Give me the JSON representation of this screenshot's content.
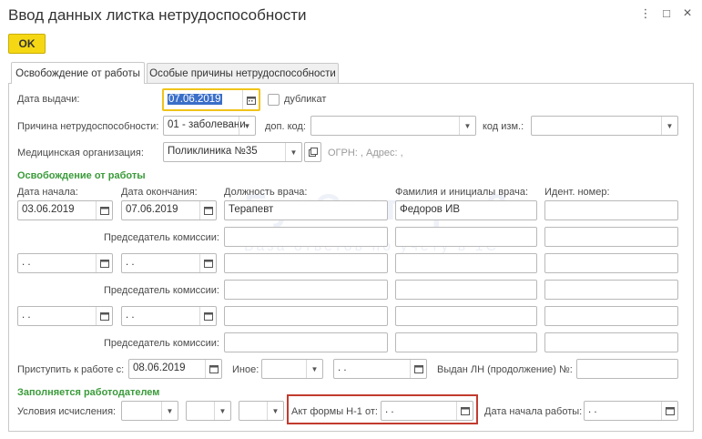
{
  "window": {
    "title": "Ввод данных листка нетрудоспособности",
    "controls": {
      "options": "⋮",
      "maximize": "□",
      "close": "×"
    }
  },
  "toolbar": {
    "ok_label": "OK"
  },
  "tabs": [
    {
      "label": "Освобождение от работы",
      "active": true
    },
    {
      "label": "Особые причины нетрудоспособности",
      "active": false
    }
  ],
  "form": {
    "issue_date_label": "Дата выдачи:",
    "issue_date_value": "07.06.2019",
    "duplicate_label": "дубликат",
    "reason_label": "Причина нетрудоспособности:",
    "reason_value": "01 - заболевани",
    "extra_code_label": "доп. код:",
    "extra_code_value": "",
    "change_code_label": "код изм.:",
    "change_code_value": "",
    "medical_org_label": "Медицинская организация:",
    "medical_org_value": "Поликлиника №35",
    "medical_org_info": "ОГРН: , Адрес: ,",
    "release_section": "Освобождение от работы",
    "col_start": "Дата начала:",
    "col_end": "Дата окончания:",
    "col_position": "Должность врача:",
    "col_name": "Фамилия и инициалы врача:",
    "col_id": "Идент. номер:",
    "rows": [
      {
        "start": "03.06.2019",
        "end": "07.06.2019",
        "position": "Терапевт",
        "name": "Федоров ИВ",
        "id": ""
      },
      {
        "start": " .  .",
        "end": " .  .",
        "position": "",
        "name": "",
        "id": ""
      },
      {
        "start": " .  .",
        "end": " .  .",
        "position": "",
        "name": "",
        "id": ""
      }
    ],
    "chairman_label": "Председатель комиссии:",
    "return_label": "Приступить к работе с:",
    "return_value": "08.06.2019",
    "other_label": "Иное:",
    "other_value": "",
    "other_date": " .  .",
    "continuation_label": "Выдан ЛН (продолжение) №:",
    "continuation_value": "",
    "employer_section": "Заполняется работодателем",
    "calc_conditions_label": "Условия исчисления:",
    "act_label": "Акт формы Н-1 от:",
    "act_value": " .  .",
    "work_start_label": "Дата начала работы:",
    "work_start_value": " .  ."
  },
  "watermark": {
    "main": "БухЭксперт 8",
    "sub": "База ответов по учёту в 1С"
  },
  "colors": {
    "ok_button": "#f5d813",
    "section_text": "#3a9b3a",
    "highlight_frame": "#c23b2e",
    "focus_border": "#f0c419"
  }
}
